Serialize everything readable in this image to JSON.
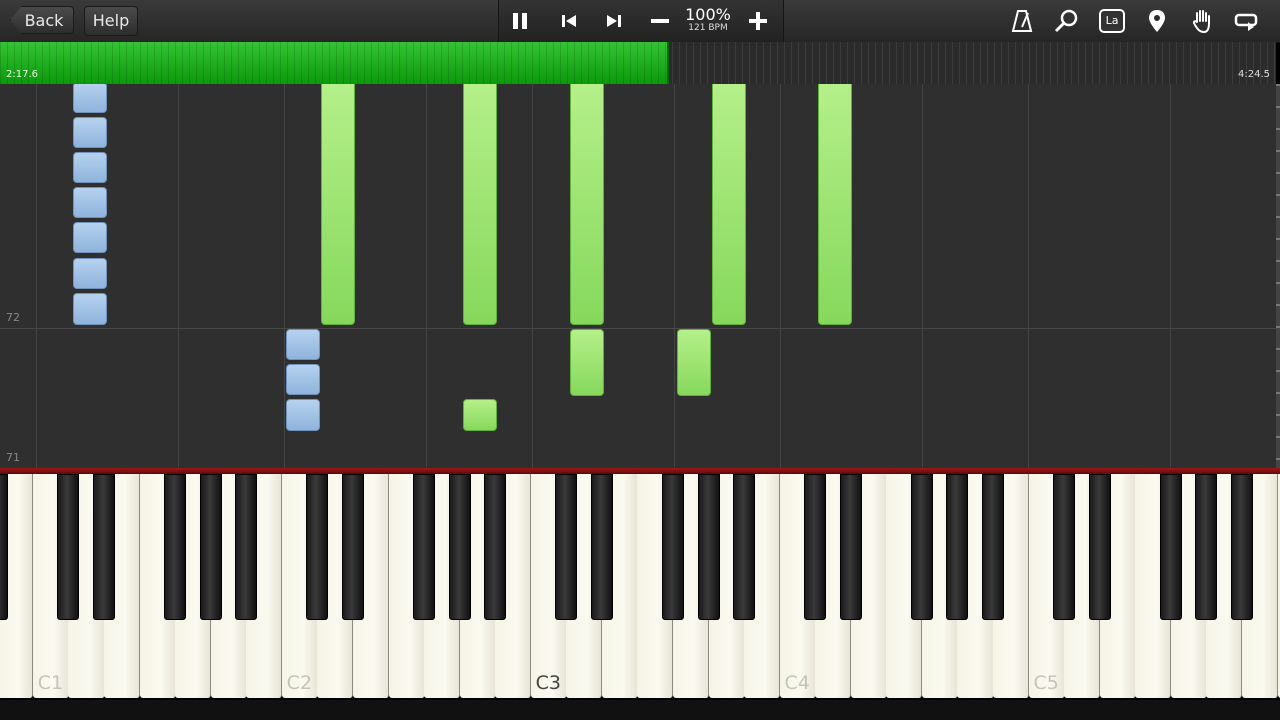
{
  "nav": {
    "back_label": "Back",
    "help_label": "Help"
  },
  "transport": {
    "pause_icon": "pause-icon",
    "prev_icon": "skip-back-icon",
    "next_icon": "skip-forward-icon",
    "minus_icon": "minus-icon",
    "plus_icon": "plus-icon",
    "tempo_percent": "100%",
    "tempo_bpm": "121 BPM"
  },
  "tools": [
    "metronome-icon",
    "zoom-icon",
    "note-label-icon",
    "location-pin-icon",
    "hand-icon",
    "loop-icon"
  ],
  "tools_note_label_text": "La",
  "progress": {
    "current": "2:17.6",
    "total": "4:24.5",
    "fraction": 0.523
  },
  "roll": {
    "lane_labels": [
      "72",
      "71"
    ]
  },
  "keyboard": {
    "octave_labels": [
      "C1",
      "C2",
      "C3",
      "C4",
      "C5"
    ]
  },
  "colors": {
    "left_hand": "#9fc1e6",
    "right_hand": "#9ee56f",
    "progress": "#1db51d"
  }
}
